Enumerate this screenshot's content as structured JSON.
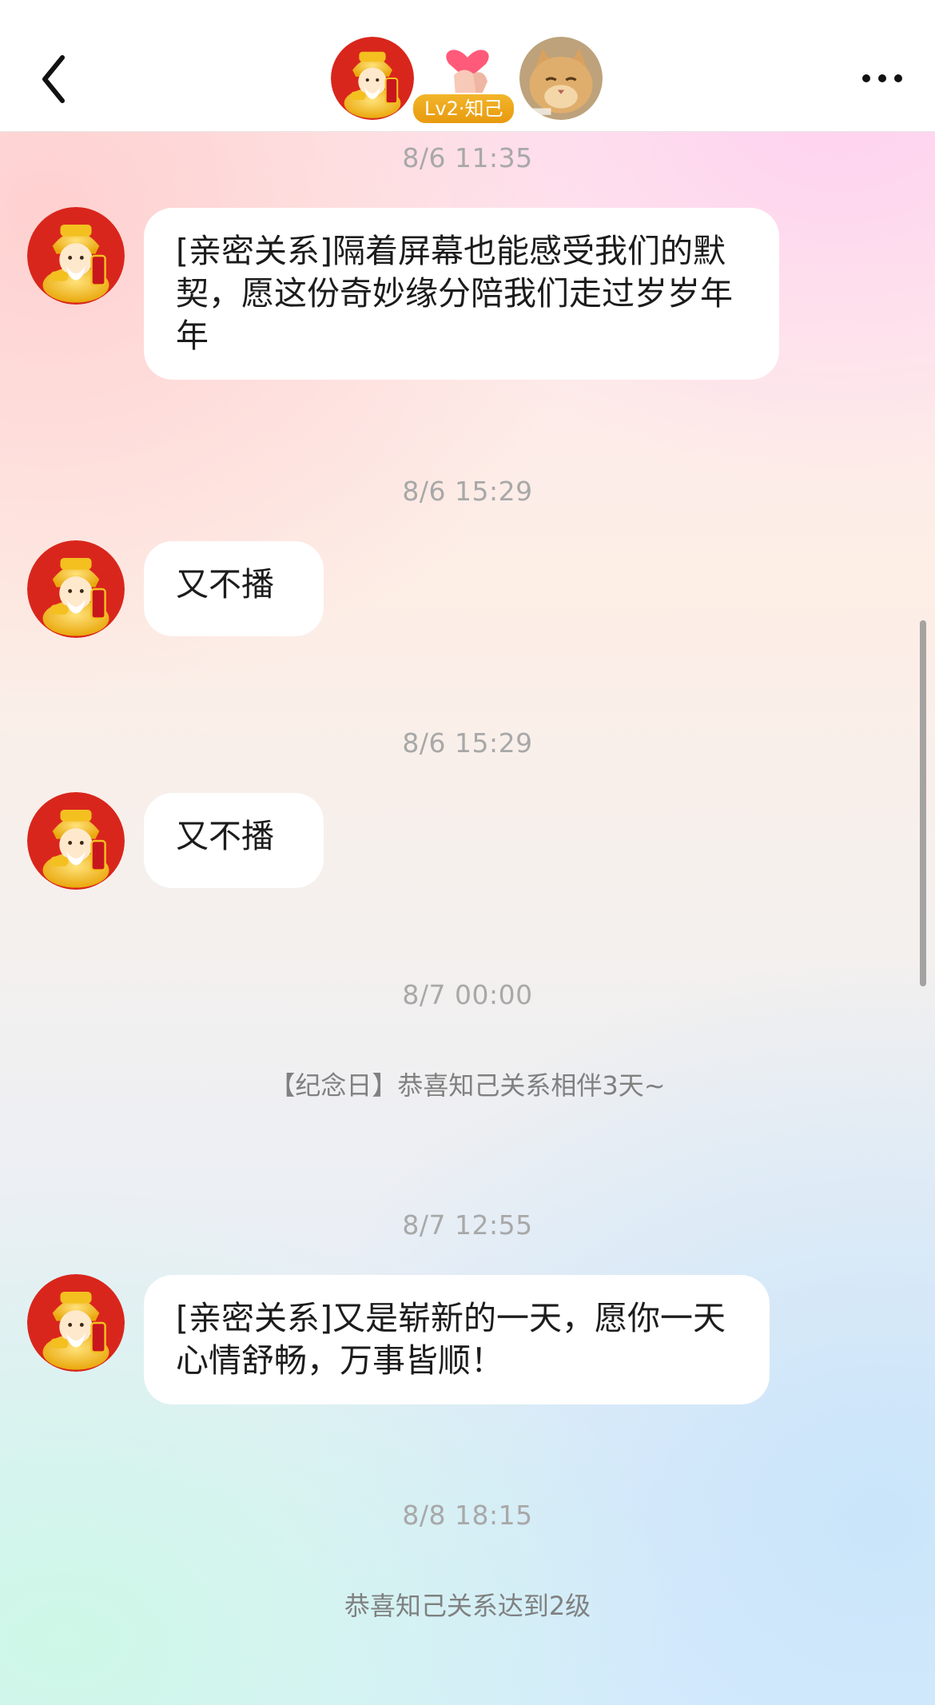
{
  "header": {
    "back_icon": "chevron-left-icon",
    "more_icon": "more-dots-icon",
    "badge_label": "Lv2·知己"
  },
  "messages": [
    {
      "time": "8/6 11:35",
      "text": "[亲密关系]隔着屏幕也能感受我们的默契，愿这份奇妙缘分陪我们走过岁岁年年"
    },
    {
      "time": "8/6 15:29",
      "text": "又不播"
    },
    {
      "time": "8/6 15:29",
      "text": "又不播"
    },
    {
      "time": "8/7 00:00",
      "notice": "【纪念日】恭喜知己关系相伴3天~"
    },
    {
      "time": "8/7 12:55",
      "text": "[亲密关系]又是崭新的一天，愿你一天心情舒畅，万事皆顺！"
    },
    {
      "time": "8/8 18:15",
      "notice": "恭喜知己关系达到2级"
    }
  ],
  "colors": {
    "badge": "#e89a0e",
    "avatar_red": "#d9261c",
    "avatar_gold": "#f4c020",
    "cat_orange": "#d9a160"
  }
}
